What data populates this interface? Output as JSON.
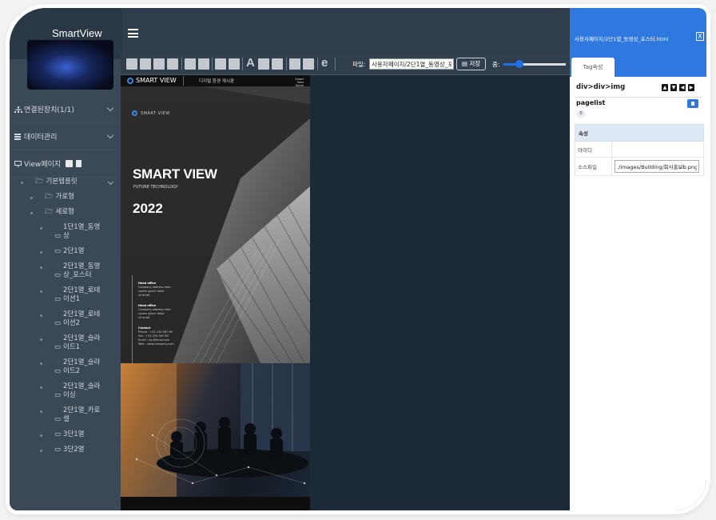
{
  "app": {
    "title": "SmartView"
  },
  "sidebar": {
    "menu": [
      {
        "icon": "sitemap-icon",
        "label": "연결된장치(1/1)"
      },
      {
        "icon": "data-icon",
        "label": "데이터관리"
      },
      {
        "icon": "monitor-icon",
        "label": "View페이지"
      }
    ],
    "tree": [
      {
        "label": "기본템플릿",
        "depth": 0
      },
      {
        "label": "가로형",
        "depth": 1
      },
      {
        "label": "세로형",
        "depth": 1
      },
      {
        "label": "1단1열_동영상",
        "depth": 2
      },
      {
        "label": "2단1열",
        "depth": 2
      },
      {
        "label": "2단1열_동영상_포스터",
        "depth": 2
      },
      {
        "label": "2단1열_로테이션1",
        "depth": 2
      },
      {
        "label": "2단1열_로테이션2",
        "depth": 2
      },
      {
        "label": "2단1열_슬라이드1",
        "depth": 2
      },
      {
        "label": "2단1열_슬라이드2",
        "depth": 2
      },
      {
        "label": "2단1열_슬라이싱",
        "depth": 2
      },
      {
        "label": "2단1열_카로셀",
        "depth": 2
      },
      {
        "label": "3단1열",
        "depth": 2
      },
      {
        "label": "3단2열",
        "depth": 2
      }
    ]
  },
  "toolbar": {
    "file_label": "파일:",
    "file_value": "사용자페이지/2단1열_동영상_포스터",
    "save_label": "저장",
    "zoom_label": "줌:",
    "zoom_fraction": 0.25
  },
  "poster": {
    "nav_brand": "SMART VIEW",
    "nav_mid": "디지털 환경 게시판",
    "nav_right": "Smart View Home",
    "logo_text": "SMART VIEW",
    "title": "SMART VIEW",
    "subtitle": "FUTURE TECHNOLOGY",
    "year": "2022",
    "info": [
      {
        "heading": "Head office",
        "lines": [
          "Company address here",
          "Lorem ipsum dolor",
          "sit amet"
        ]
      },
      {
        "heading": "Head office",
        "lines": [
          "Company address here",
          "Lorem ipsum dolor",
          "sit amet"
        ]
      },
      {
        "heading": "Contact",
        "lines": [
          "Phone : +01 234 567 89",
          "Fax : +01 234 567 89",
          "Email : you@mail.com",
          "Web : www.company.com"
        ]
      }
    ]
  },
  "panel": {
    "path": "사용자페이지/2단1열_동영상_포스터.html",
    "close": "X",
    "tab": "Tag속성",
    "node_path": "div>div>img",
    "pagelist_label": "pagelist",
    "pagelist_count": "0",
    "attr_header": "속성",
    "attrs": [
      {
        "key": "아이디",
        "value": ""
      },
      {
        "key": "소스파일",
        "value": "./images/Building/회사홍보b.png"
      }
    ]
  }
}
